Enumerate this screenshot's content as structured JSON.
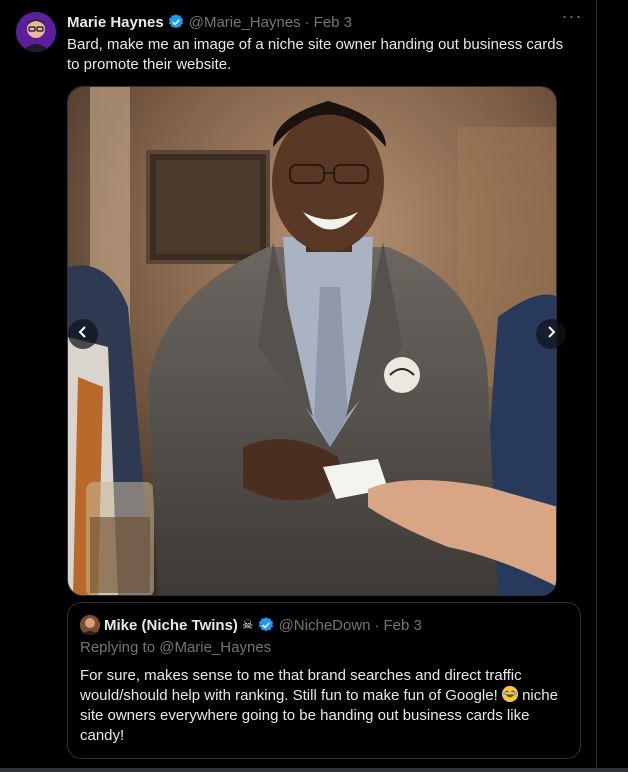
{
  "tweet": {
    "author_name": "Marie Haynes",
    "handle": "@Marie_Haynes",
    "separator": "·",
    "date": "Feb 3",
    "more_label": "···",
    "text": "Bard, make me an image of a niche site owner handing out business cards to promote their website.",
    "verified_icon": "verified-badge-icon",
    "verified_color": "#1d9bf0"
  },
  "media": {
    "icon_left": "chevron-left-icon",
    "icon_right": "chevron-right-icon"
  },
  "quote": {
    "author_name": "Mike (Niche Twins)",
    "author_emoji": "☠",
    "handle": "@NicheDown",
    "separator": "·",
    "date": "Feb 3",
    "replying_prefix": "Replying to",
    "replying_handle": "@Marie_Haynes",
    "text_part1": "For sure, makes sense to me that brand searches and direct traffic would/should help with ranking. Still fun to make fun of Google!",
    "text_part2": "niche site owners everywhere going to be handing out business cards like candy!",
    "emoji_icon": "laughing-face-icon"
  },
  "colors": {
    "background": "#000000",
    "text_primary": "#e7e9ea",
    "text_secondary": "#71767b",
    "border": "#2f3336",
    "accent": "#1d9bf0"
  }
}
